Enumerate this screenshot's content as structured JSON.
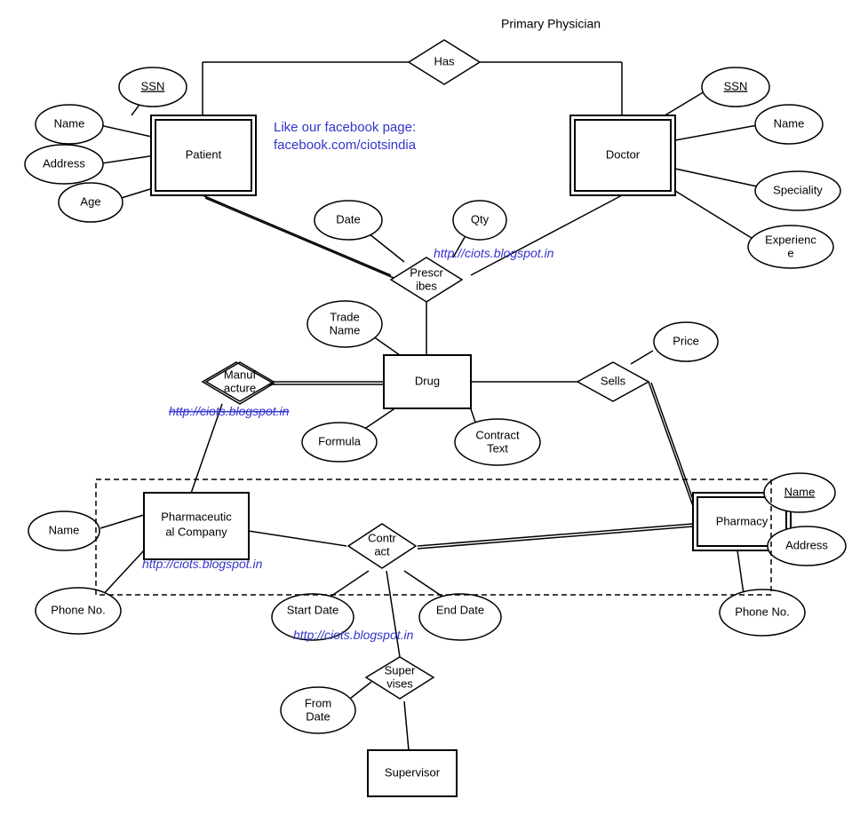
{
  "entities": {
    "patient": "Patient",
    "doctor": "Doctor",
    "drug": "Drug",
    "pharmaCompany": "Pharmaceutical Company",
    "pharmacy": "Pharmacy",
    "supervisor": "Supervisor"
  },
  "relationships": {
    "has": "Has",
    "prescribes": "Prescribes",
    "manufacture": "Manufacture",
    "sells": "Sells",
    "contract": "Contract",
    "supervises": "Supervises"
  },
  "attributes": {
    "patient": {
      "ssn": "SSN",
      "name": "Name",
      "address": "Address",
      "age": "Age"
    },
    "doctor": {
      "ssn": "SSN",
      "name": "Name",
      "speciality": "Speciality",
      "experience": "Experience"
    },
    "prescribes": {
      "date": "Date",
      "qty": "Qty"
    },
    "drug": {
      "tradeName": "Trade Name",
      "formula": "Formula",
      "contractText": "Contract Text"
    },
    "sells": {
      "price": "Price"
    },
    "pharmaCompany": {
      "name": "Name",
      "phoneNo": "Phone No."
    },
    "pharmacy": {
      "name": "Name",
      "address": "Address",
      "phoneNo": "Phone No."
    },
    "contract": {
      "startDate": "Start Date",
      "endDate": "End Date"
    },
    "supervises": {
      "fromDate": "From Date"
    }
  },
  "labels": {
    "primaryPhysician": "Primary Physician"
  },
  "watermarks": {
    "facebook1": "Like our facebook page:",
    "facebook2": "facebook.com/ciotsindia",
    "blog": "http://ciots.blogspot.in"
  }
}
